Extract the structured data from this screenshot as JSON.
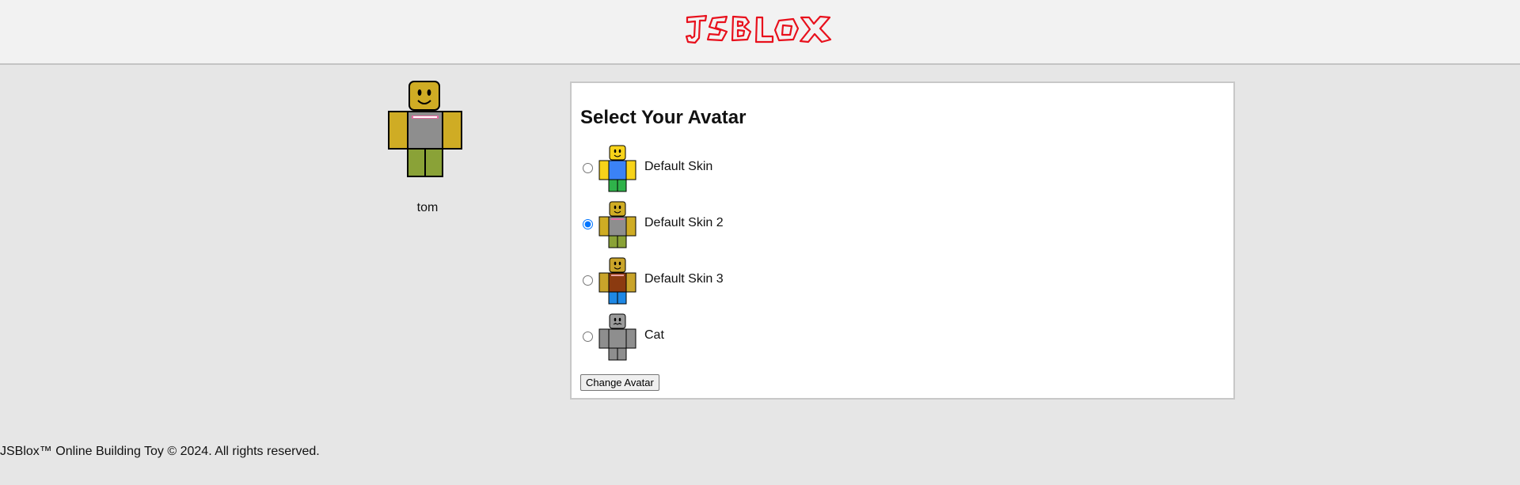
{
  "header": {
    "logo_text": "JSBLOX",
    "logo_color": "#e8101c"
  },
  "profile": {
    "username": "tom"
  },
  "avatar_form": {
    "title": "Select Your Avatar",
    "options": [
      {
        "label": "Default Skin",
        "selected": false,
        "icon": "default-skin-avatar-icon"
      },
      {
        "label": "Default Skin 2",
        "selected": true,
        "icon": "default-skin-2-avatar-icon"
      },
      {
        "label": "Default Skin 3",
        "selected": false,
        "icon": "default-skin-3-avatar-icon"
      },
      {
        "label": "Cat",
        "selected": false,
        "icon": "cat-avatar-icon"
      }
    ],
    "submit_label": "Change Avatar"
  },
  "footer": {
    "text": "JSBlox™ Online Building Toy © 2024. All rights reserved."
  }
}
